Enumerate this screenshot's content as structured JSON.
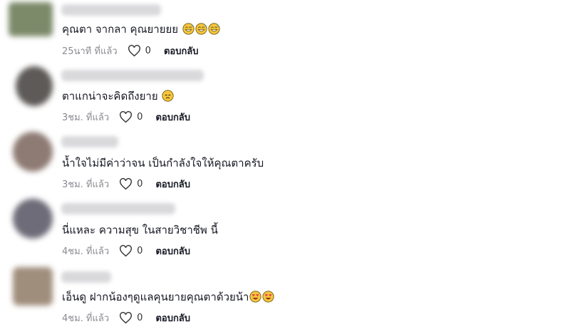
{
  "comments": [
    {
      "text": "คุณตา จากลา คุณยายยย",
      "emojis": [
        "grin-sweat",
        "grin-sweat",
        "grin-sweat"
      ],
      "time": "25นาที ที่แล้ว",
      "likes": "0",
      "reply": "ตอบกลับ",
      "avatar_color": "#7c8a6a"
    },
    {
      "text": "ตาแกน่าจะคิดถึงยาย",
      "emojis": [
        "pensive"
      ],
      "time": "3ชม. ที่แล้ว",
      "likes": "0",
      "reply": "ตอบกลับ",
      "avatar_color": "#5d5a57"
    },
    {
      "text": "น้ำใจไม่มีค่าว่าจน เป็นกำลังใจให้คุณตาครับ",
      "emojis": [],
      "time": "3ชม. ที่แล้ว",
      "likes": "0",
      "reply": "ตอบกลับ",
      "avatar_color": "#8e7b74"
    },
    {
      "text": "นี่แหละ ความสุข ในสายวิชาชีพ นี้",
      "emojis": [],
      "time": "4ชม. ที่แล้ว",
      "likes": "0",
      "reply": "ตอบกลับ",
      "avatar_color": "#6e6c78"
    },
    {
      "text": "เอ็นดู ฝากน้องๆดูแลคุนยายคุณตาด้วยน้า",
      "emojis": [
        "heart-eyes",
        "heart-eyes"
      ],
      "time": "4ชม. ที่แล้ว",
      "likes": "0",
      "reply": "ตอบกลับ",
      "avatar_color": "#a08e7c"
    }
  ]
}
